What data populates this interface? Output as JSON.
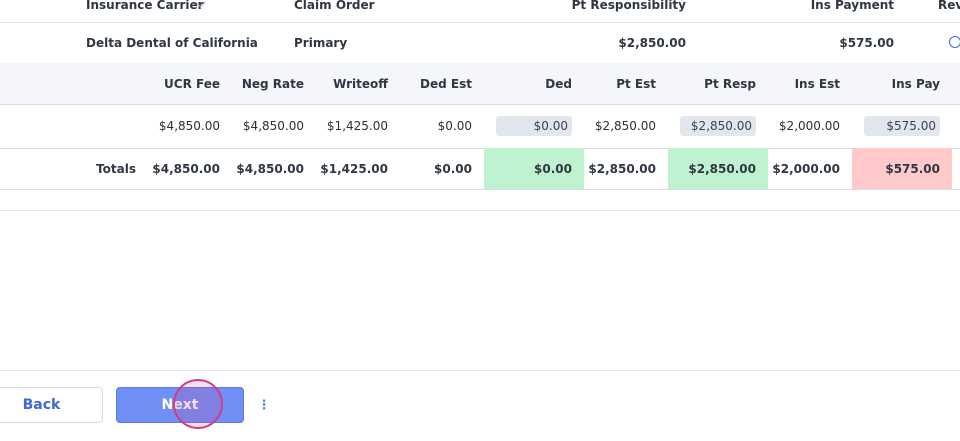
{
  "carrier_table": {
    "headers": {
      "insurance_carrier": "Insurance Carrier",
      "claim_order": "Claim Order",
      "pt_responsibility": "Pt Responsibility",
      "ins_payment": "Ins Payment",
      "rev": "Rev"
    },
    "row": {
      "insurance_carrier": "Delta Dental of California",
      "claim_order": "Primary",
      "pt_responsibility": "$2,850.00",
      "ins_payment": "$575.00"
    }
  },
  "fee_table": {
    "headers": [
      "UCR Fee",
      "Neg Rate",
      "Writeoff",
      "Ded Est",
      "Ded",
      "Pt Est",
      "Pt Resp",
      "Ins Est",
      "Ins Pay"
    ],
    "row": [
      "$4,850.00",
      "$4,850.00",
      "$1,425.00",
      "$0.00",
      "$0.00",
      "$2,850.00",
      "$2,850.00",
      "$2,000.00",
      "$575.00"
    ],
    "totals_label": "Totals",
    "totals": [
      "$4,850.00",
      "$4,850.00",
      "$1,425.00",
      "$0.00",
      "$0.00",
      "$2,850.00",
      "$2,850.00",
      "$2,000.00",
      "$575.00"
    ]
  },
  "footer": {
    "back_label": "Back",
    "next_label": "Next",
    "more_icon": "⋮"
  },
  "colors": {
    "ded_total_fill": "#bff2cf",
    "pt_resp_total_fill": "#bff2cf",
    "ins_pay_total_fill": "#ffc9c9",
    "primary_button": "#6f8ff5",
    "accent_text": "#3c68d8"
  }
}
